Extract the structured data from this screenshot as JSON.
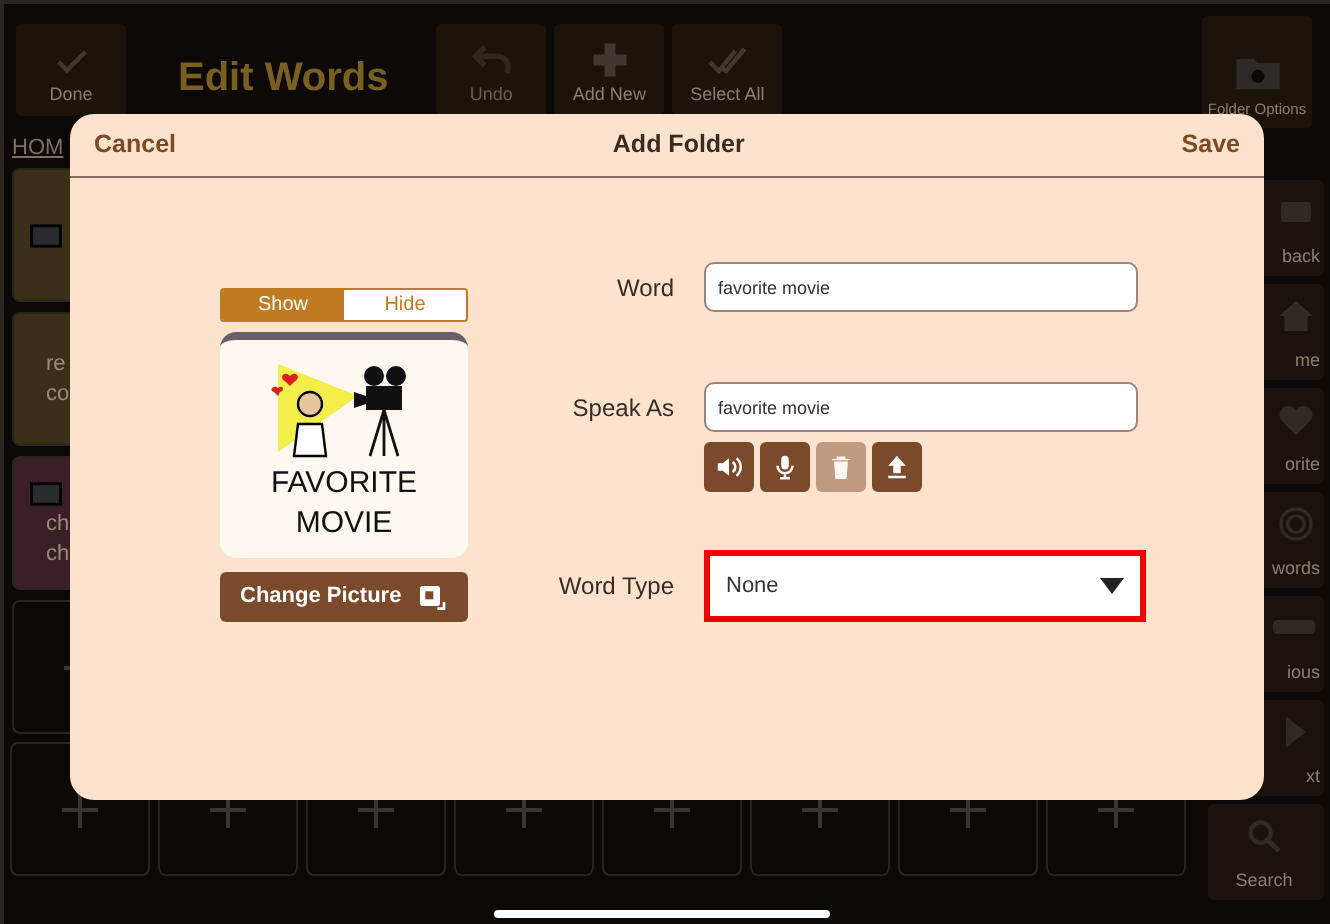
{
  "app_bar": {
    "done": "Done",
    "title": "Edit Words",
    "tools": [
      {
        "kind": "undo",
        "label": "Undo",
        "disabled": true
      },
      {
        "kind": "add",
        "label": "Add New",
        "disabled": false
      },
      {
        "kind": "select",
        "label": "Select All",
        "disabled": false
      }
    ],
    "folder_options": "Folder Options"
  },
  "breadcrumb": "HOM",
  "left_tiles": [
    {
      "kind": "picture",
      "color": "#3a3018"
    },
    {
      "kind": "text",
      "lines": [
        "re",
        "co"
      ],
      "color": "#3a3018"
    },
    {
      "kind": "picture",
      "lines": [
        "ch",
        "ch"
      ],
      "color": "#3a1e28"
    },
    {
      "kind": "empty",
      "color": "#0c0907"
    }
  ],
  "side_items": [
    {
      "kind": "back",
      "label": "back"
    },
    {
      "kind": "home",
      "label": "me"
    },
    {
      "kind": "heart",
      "label": "orite"
    },
    {
      "kind": "rings",
      "label": "words"
    },
    {
      "kind": "bar",
      "label": "ious"
    },
    {
      "kind": "next",
      "label": "xt"
    },
    {
      "kind": "search",
      "label": "Search"
    }
  ],
  "dialog": {
    "cancel": "Cancel",
    "title": "Add Folder",
    "save": "Save",
    "picture_toggle": [
      {
        "label": "Show",
        "selected": true
      },
      {
        "label": "Hide",
        "selected": false
      }
    ],
    "card_label": "FAVORITE MOVIE",
    "change_picture": "Change Picture",
    "fields": [
      {
        "label": "Word",
        "value": "favorite movie"
      },
      {
        "label": "Speak As",
        "value": "favorite movie"
      }
    ],
    "audio_buttons": [
      {
        "kind": "play",
        "disabled": false
      },
      {
        "kind": "record",
        "disabled": false
      },
      {
        "kind": "delete",
        "disabled": true
      },
      {
        "kind": "upload",
        "disabled": false
      }
    ],
    "word_type": {
      "label": "Word Type",
      "value": "None",
      "highlighted": true
    }
  }
}
